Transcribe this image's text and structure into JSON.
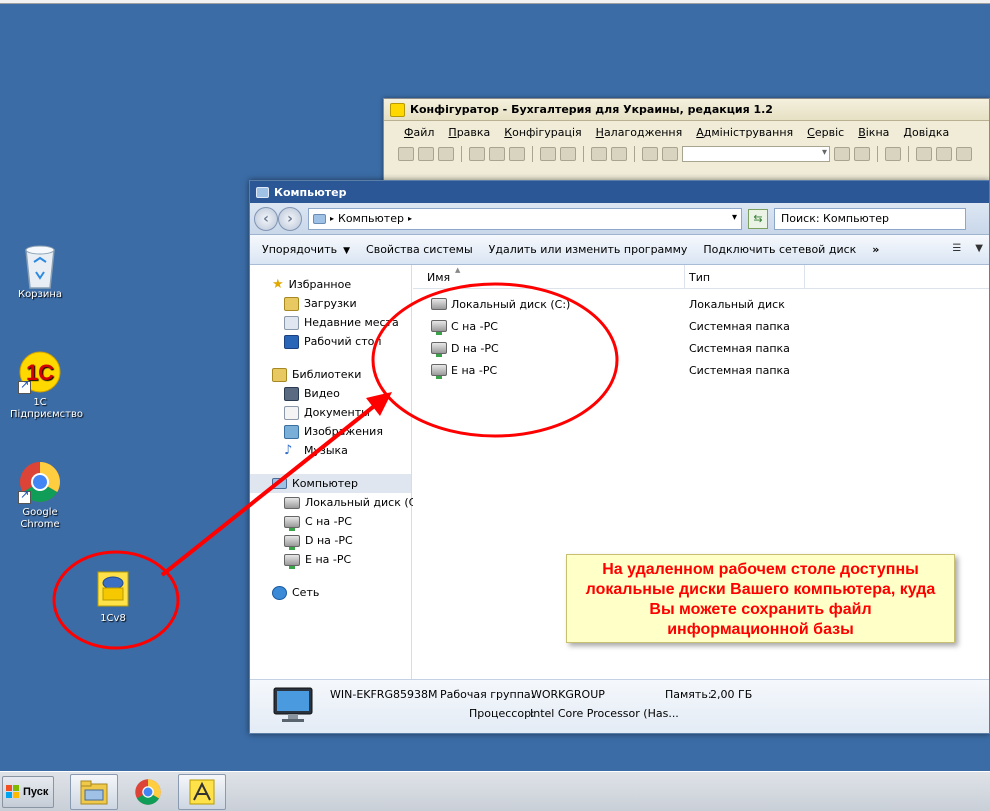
{
  "desktop": {
    "icons": [
      {
        "label": "Корзина"
      },
      {
        "label": "1С Підприємство"
      },
      {
        "label": "Google Chrome"
      },
      {
        "label": "1Cv8"
      }
    ]
  },
  "configurator": {
    "title": "Конфігуратор - Бухгалтерия для Украины, редакция 1.2",
    "menu": [
      "Файл",
      "Правка",
      "Конфігурація",
      "Налагодження",
      "Адміністрування",
      "Сервіс",
      "Вікна",
      "Довідка"
    ]
  },
  "explorer": {
    "title": "Компьютер",
    "address": "Компьютер",
    "search_placeholder": "Поиск: Компьютер",
    "commands": {
      "organize": "Упорядочить",
      "sys_props": "Свойства системы",
      "uninstall": "Удалить или изменить программу",
      "map_drive": "Подключить сетевой диск",
      "more": "»"
    },
    "nav": {
      "favorites": "Избранное",
      "downloads": "Загрузки",
      "recent": "Недавние места",
      "desktop": "Рабочий стол",
      "libraries": "Библиотеки",
      "video": "Видео",
      "documents": "Документы",
      "pictures": "Изображения",
      "music": "Музыка",
      "computer": "Компьютер",
      "local_disk": "Локальный диск (C:)",
      "c_pc": "C на -PC",
      "d_pc": "D на -PC",
      "e_pc": "E на -PC",
      "network": "Сеть"
    },
    "columns": {
      "name": "Имя",
      "type": "Тип"
    },
    "files": [
      {
        "name": "Локальный диск (C:)",
        "type": "Локальный диск"
      },
      {
        "name": "C на -PC",
        "type": "Системная папка"
      },
      {
        "name": "D на -PC",
        "type": "Системная папка"
      },
      {
        "name": "E на -PC",
        "type": "Системная папка"
      }
    ],
    "details": {
      "computer_name": "WIN-EKFRG85938M",
      "workgroup_label": "Рабочая группа:",
      "workgroup": "WORKGROUP",
      "memory_label": "Память:",
      "memory": "2,00 ГБ",
      "processor_label": "Процессор:",
      "processor": "Intel Core Processor (Has..."
    }
  },
  "callout": {
    "line1": "На удаленном рабочем столе доступны",
    "line2": "локальные диски Вашего компьютера, куда",
    "line3": "Вы можете сохранить файл",
    "line4": "информационной базы"
  },
  "taskbar": {
    "start_label": "Пуск",
    "items": [
      "explorer",
      "chrome",
      "1c-configurator"
    ]
  },
  "colors": {
    "desktop": "#3b6ca6",
    "annotation": "#ff0000",
    "callout_bg": "#ffffc8"
  }
}
